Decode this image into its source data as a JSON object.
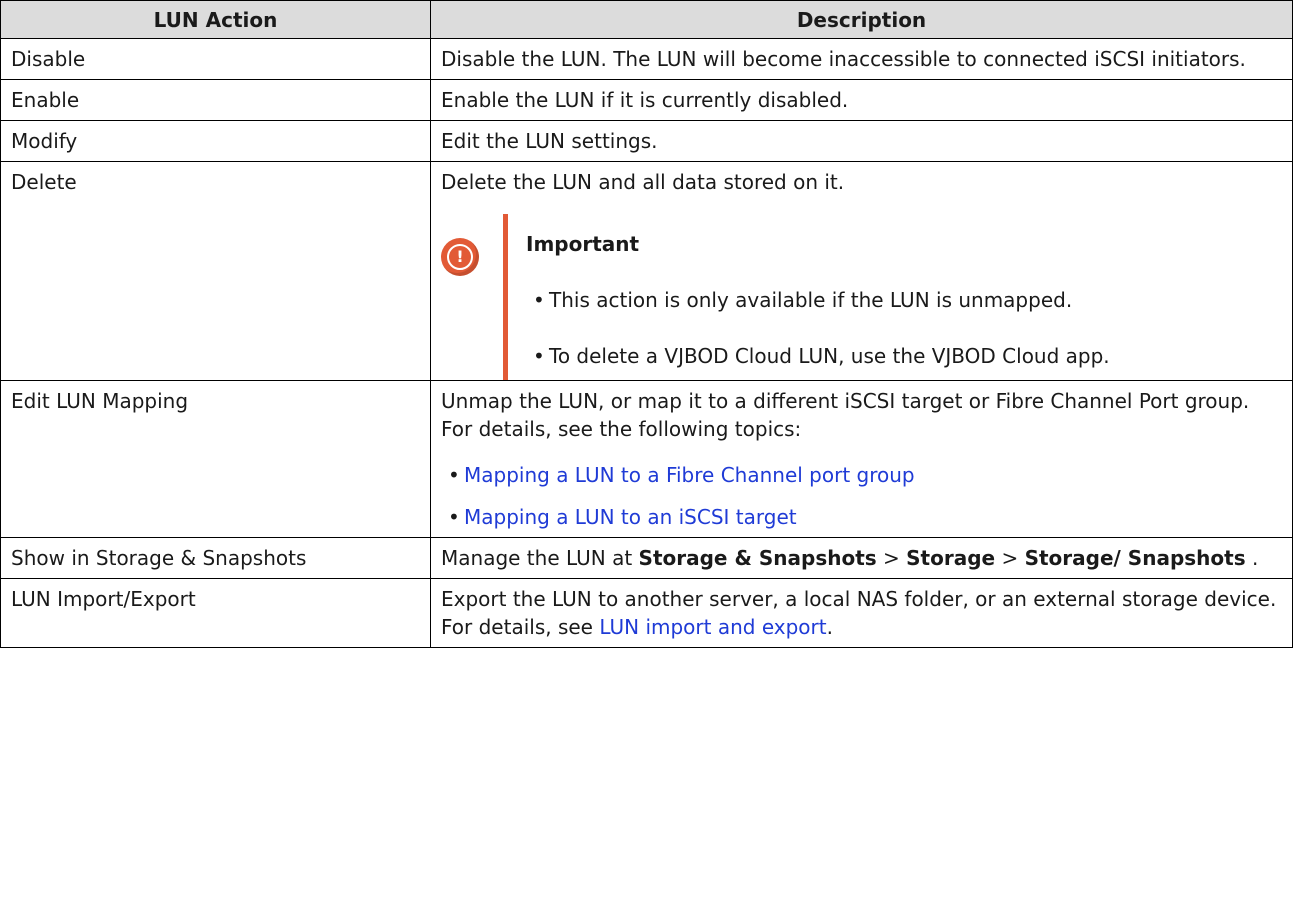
{
  "table": {
    "headers": [
      "LUN Action",
      "Description"
    ],
    "rows": {
      "disable": {
        "action": "Disable",
        "description": "Disable the LUN. The LUN will become inaccessible to connected iSCSI initiators."
      },
      "enable": {
        "action": "Enable",
        "description": "Enable the LUN if it is currently disabled."
      },
      "modify": {
        "action": "Modify",
        "description": "Edit the LUN settings."
      },
      "delete": {
        "action": "Delete",
        "description": "Delete the LUN and all data stored on it.",
        "note": {
          "title": "Important",
          "icon": "exclamation-icon",
          "color": "#e25a36",
          "items": [
            "This action is only available if the LUN is unmapped.",
            "To delete a VJBOD Cloud LUN, use the VJBOD Cloud app."
          ]
        }
      },
      "edit_mapping": {
        "action": "Edit LUN Mapping",
        "description": "Unmap the LUN, or map it to a different iSCSI target or Fibre Channel Port group.",
        "details_intro": "For details, see the following topics:",
        "links": [
          "Mapping a LUN to a Fibre Channel port group",
          "Mapping a LUN to an iSCSI target"
        ]
      },
      "show_storage": {
        "action": "Show in Storage & Snapshots",
        "desc_prefix": "Manage the LUN at ",
        "path": [
          "Storage & Snapshots",
          "Storage",
          "Storage/ Snapshots"
        ],
        "separator": " > ",
        "suffix": " ."
      },
      "import_export": {
        "action": "LUN Import/Export",
        "description": "Export the LUN to another server, a local NAS folder, or an external storage device.",
        "details_prefix": "For details, see ",
        "link": "LUN import and export",
        "details_suffix": "."
      }
    }
  },
  "colors": {
    "link": "#1f3bd6",
    "header_bg": "#dcdcdc",
    "important": "#e25a36"
  }
}
